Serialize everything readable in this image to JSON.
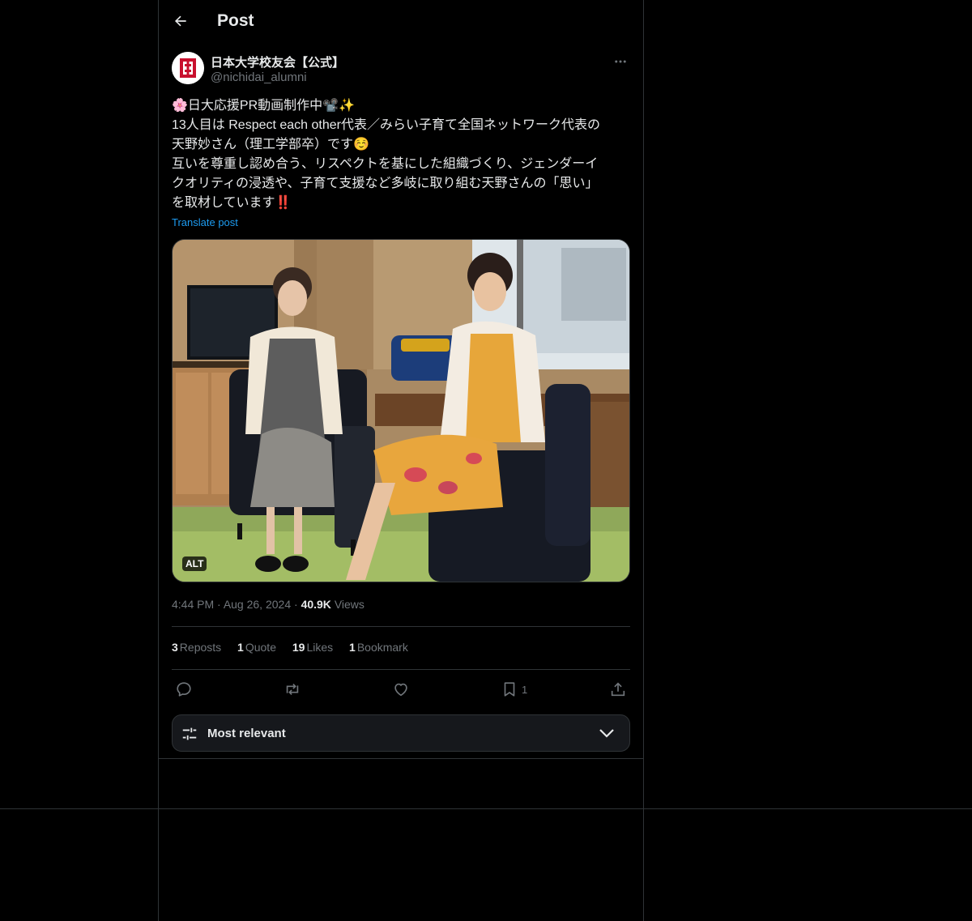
{
  "header": {
    "title": "Post"
  },
  "author": {
    "display_name": "日本大学校友会【公式】",
    "handle": "@nichidai_alumni"
  },
  "post": {
    "lines": [
      "🌸日大応援PR動画制作中📽️✨",
      "13人目は Respect each other代表／みらい子育て全国ネットワーク代表の",
      "天野妙さん（理工学部卒）です☺️",
      "互いを尊重し認め合う、リスペクトを基にした組織づくり、ジェンダーイ",
      "クオリティの浸透や、子育て支援など多岐に取り組む天野さんの「思い」",
      "を取材しています‼️"
    ],
    "translate_label": "Translate post",
    "alt_badge": "ALT"
  },
  "meta": {
    "time": "4:44 PM",
    "date": "Aug 26, 2024",
    "views_count": "40.9K",
    "views_label": "Views"
  },
  "stats": {
    "reposts_count": "3",
    "reposts_label": "Reposts",
    "quotes_count": "1",
    "quotes_label": "Quote",
    "likes_count": "19",
    "likes_label": "Likes",
    "bookmarks_count": "1",
    "bookmarks_label": "Bookmark"
  },
  "actions": {
    "bookmark_count": "1",
    "icons": [
      "reply-icon",
      "repost-icon",
      "like-icon",
      "bookmark-icon",
      "share-icon"
    ]
  },
  "replies_sort": {
    "label": "Most relevant"
  },
  "colors": {
    "background": "#000000",
    "text": "#e7e9ea",
    "muted": "#71767b",
    "accent": "#1d9bf0",
    "border": "#2f3336"
  }
}
